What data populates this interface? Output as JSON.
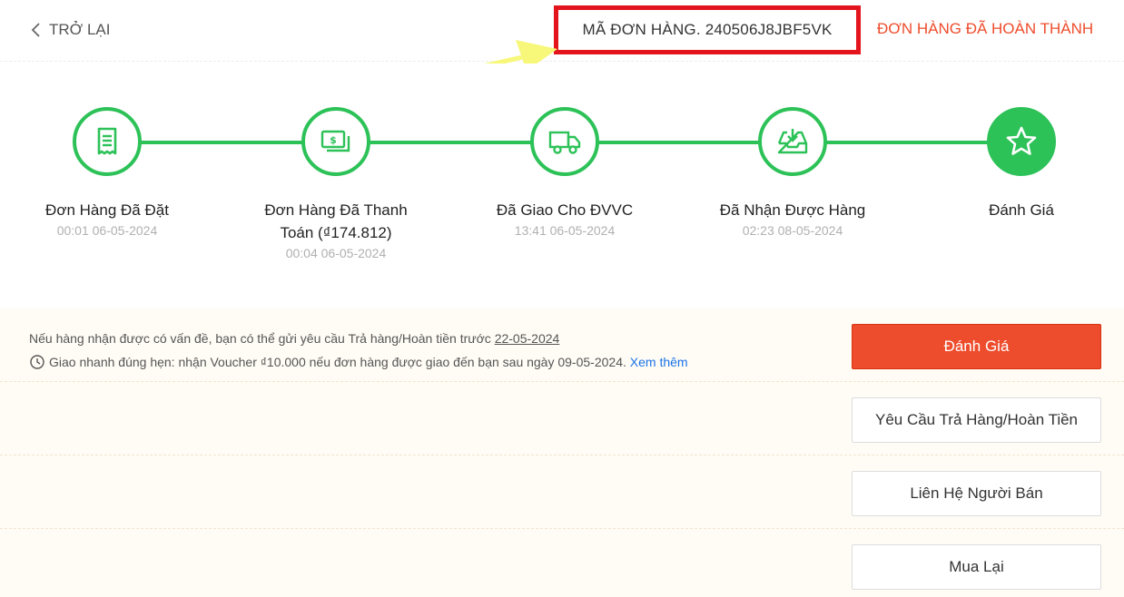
{
  "header": {
    "back_label": "TRỞ LẠI",
    "order_id_label": "MÃ ĐƠN HÀNG. 240506J8JBF5VK",
    "order_status": "ĐƠN HÀNG ĐÃ HOÀN THÀNH"
  },
  "steps": [
    {
      "label": "Đơn Hàng Đã Đặt",
      "time": "00:01 06-05-2024",
      "icon": "receipt-icon"
    },
    {
      "label": "Đơn Hàng Đã Thanh Toán (₫174.812)",
      "time": "00:04 06-05-2024",
      "icon": "money-icon"
    },
    {
      "label": "Đã Giao Cho ĐVVC",
      "time": "13:41 06-05-2024",
      "icon": "truck-icon"
    },
    {
      "label": "Đã Nhận Được Hàng",
      "time": "02:23 08-05-2024",
      "icon": "inbox-download-icon"
    },
    {
      "label": "Đánh Giá",
      "time": "",
      "icon": "star-icon"
    }
  ],
  "notice": {
    "return_text": "Nếu hàng nhận được có vấn đề, bạn có thể gửi yêu cầu Trả hàng/Hoàn tiền trước",
    "return_deadline": "22-05-2024",
    "voucher_text": "Giao nhanh đúng hẹn: nhận Voucher ₫10.000 nếu đơn hàng được giao đến bạn sau ngày 09-05-2024.",
    "voucher_link": "Xem thêm"
  },
  "buttons": {
    "rate": "Đánh Giá",
    "return_request": "Yêu Cầu Trả Hàng/Hoàn Tiền",
    "contact_seller": "Liên Hệ Người Bán",
    "buy_again": "Mua Lại"
  },
  "colors": {
    "accent": "#ee4d2d",
    "progress": "#2dc258",
    "highlight_box": "#e3141b",
    "annotation_arrow": "#f7f77a"
  }
}
